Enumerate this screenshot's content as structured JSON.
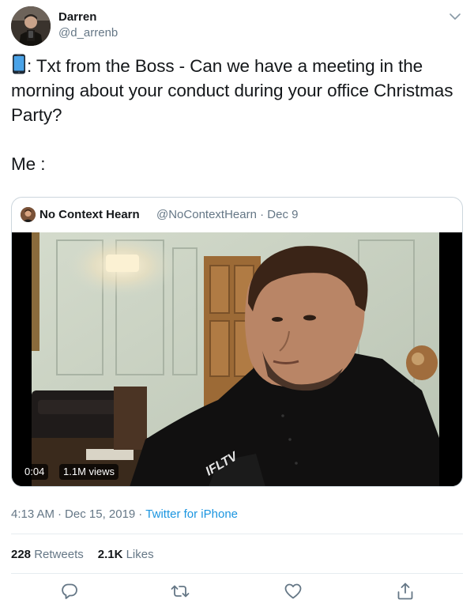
{
  "author": {
    "name": "Darren",
    "handle": "@d_arrenb"
  },
  "tweet": {
    "emoji_icon": "mobile-phone-icon",
    "line1": ": Txt from the Boss - Can we have a meeting in the",
    "line2": "morning about your conduct during your office Christmas",
    "line3": "Party?",
    "line4": "Me :"
  },
  "quoted_tweet": {
    "name": "No Context Hearn",
    "handle": "@NoContextHearn",
    "date": "Dec 9",
    "video": {
      "duration": "0:04",
      "views": "1.1M views",
      "watermark": "IFLTV"
    }
  },
  "meta": {
    "time": "4:13 AM",
    "date": "Dec 15, 2019",
    "source": "Twitter for iPhone"
  },
  "stats": {
    "retweets_count": "228",
    "retweets_label": "Retweets",
    "likes_count": "2.1K",
    "likes_label": "Likes"
  },
  "actions": [
    "reply-icon",
    "retweet-icon",
    "like-icon",
    "share-icon"
  ],
  "colors": {
    "text": "#14171a",
    "secondary": "#657786",
    "link": "#1b95e0",
    "border": "#e6ecf0"
  }
}
